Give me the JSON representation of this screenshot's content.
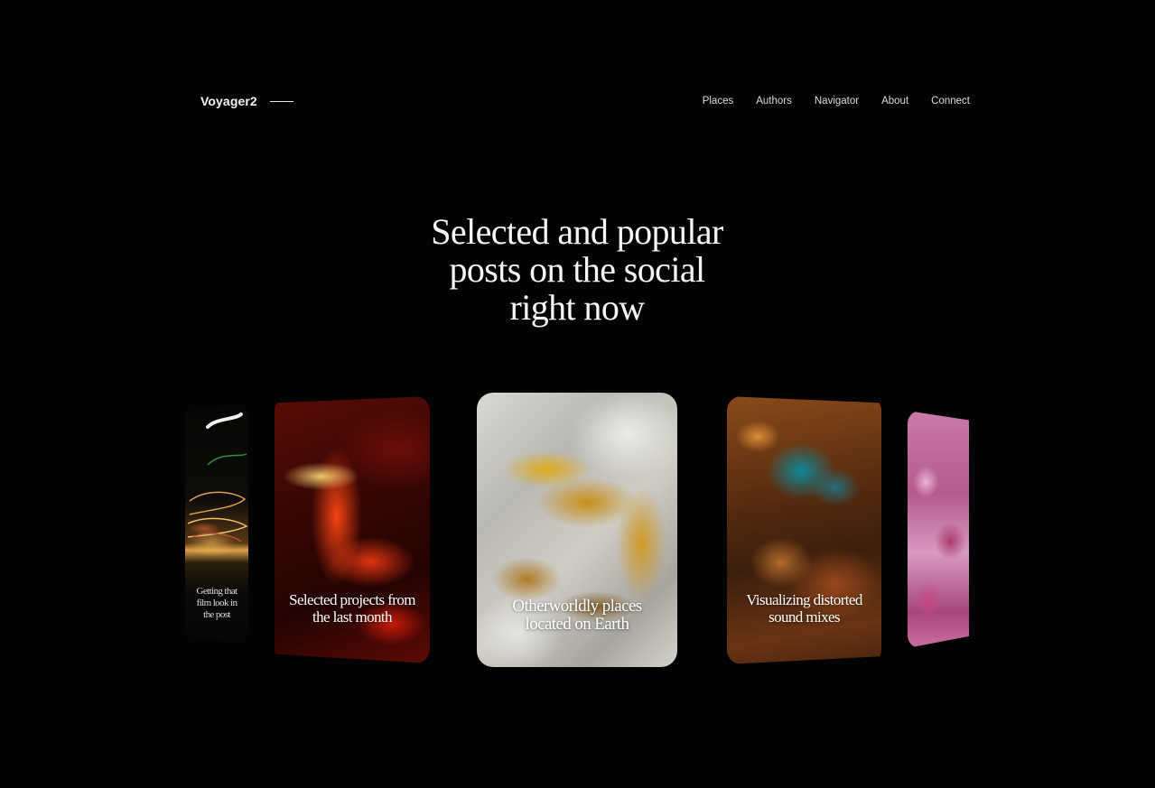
{
  "brand": {
    "name": "Voyager2"
  },
  "nav": {
    "items": [
      "Places",
      "Authors",
      "Navigator",
      "About",
      "Connect"
    ]
  },
  "hero": {
    "headline_lines": [
      "Selected and popular",
      "posts on the social",
      "right now"
    ]
  },
  "cards": [
    {
      "caption_lines": [
        "Getting that film look in",
        "the post"
      ]
    },
    {
      "caption_lines": [
        "Selected projects from",
        "the last month"
      ]
    },
    {
      "caption_lines": [
        "Otherworldly places",
        "located on Earth"
      ]
    },
    {
      "caption_lines": [
        "Visualizing distorted",
        "sound mixes"
      ]
    },
    {
      "caption_lines": [
        "",
        ""
      ]
    }
  ],
  "colors": {
    "background": "#030303",
    "text": "#f2f2f2"
  }
}
